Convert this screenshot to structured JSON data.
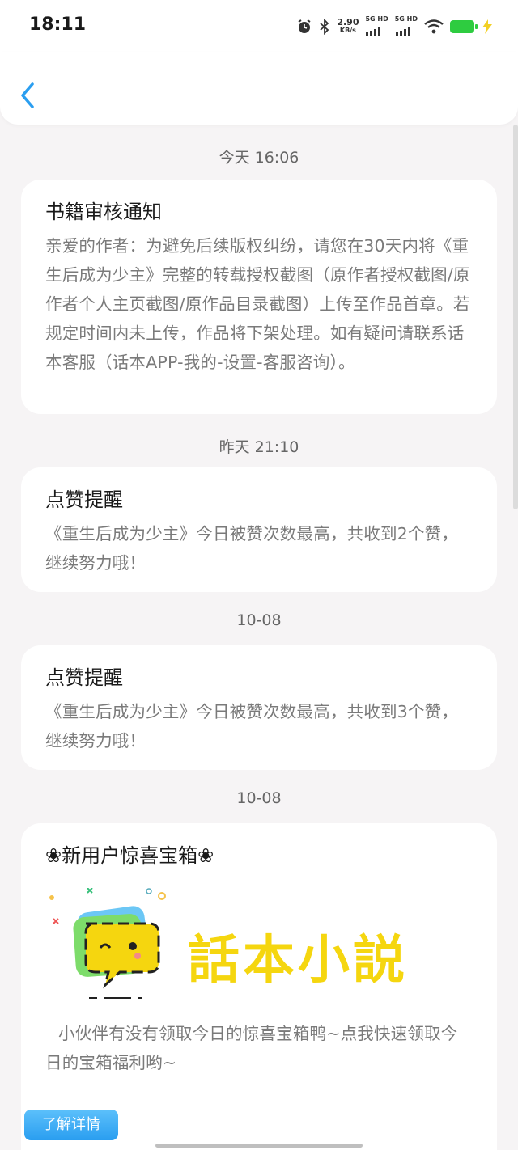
{
  "status_bar": {
    "time": "18:11",
    "net_speed": "2.90",
    "net_unit": "KB/s",
    "sim1": "5G HD",
    "sim2": "5G HD"
  },
  "colors": {
    "accent": "#2a9ef0",
    "battery": "#2ecc40",
    "logo_yellow": "#f5d60f"
  },
  "messages": [
    {
      "timestamp": "今天 16:06",
      "title": "书籍审核通知",
      "body": "亲爱的作者：为避免后续版权纠纷，请您在30天内将《重生后成为少主》完整的转载授权截图（原作者授权截图/原作者个人主页截图/原作品目录截图）上传至作品首章。若规定时间内未上传，作品将下架处理。如有疑问请联系话本客服（话本APP-我的-设置-客服咨询）。"
    },
    {
      "timestamp": "昨天 21:10",
      "title": "点赞提醒",
      "body": "《重生后成为少主》今日被赞次数最高，共收到2个赞，继续努力哦！"
    },
    {
      "timestamp": "10-08",
      "title": "点赞提醒",
      "body": "《重生后成为少主》今日被赞次数最高，共收到3个赞，继续努力哦！"
    },
    {
      "timestamp": "10-08",
      "title": "❀新用户惊喜宝箱❀",
      "logo_text": "話本小説",
      "body": "小伙伴有没有领取今日的惊喜宝箱鸭~点我快速领取今日的宝箱福利哟~",
      "button_label": "了解详情"
    }
  ]
}
